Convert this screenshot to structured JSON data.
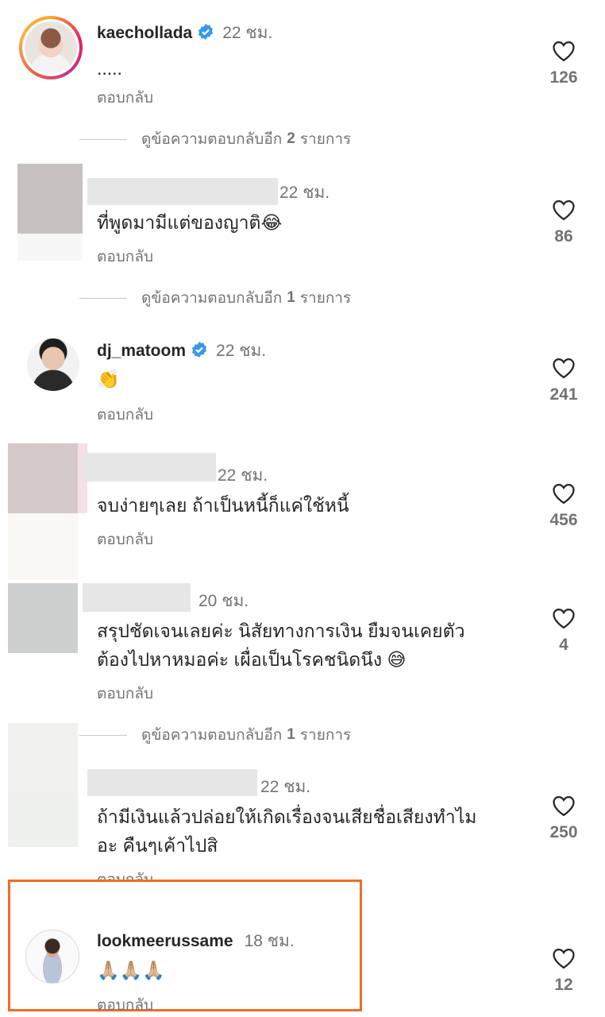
{
  "reply_label": "ตอบกลับ",
  "comments": [
    {
      "username": "kaechollada",
      "verified": true,
      "time": "22 ชม.",
      "text": ".....",
      "likes": "126"
    },
    {
      "username": "",
      "verified": false,
      "time": "22 ชม.",
      "text": "ที่พูดมามีแต่ของญาติ😂",
      "likes": "86"
    },
    {
      "username": "dj_matoom",
      "verified": true,
      "time": "22 ชม.",
      "text": "👏",
      "likes": "241"
    },
    {
      "username": "",
      "verified": false,
      "time": "22 ชม.",
      "text": "จบง่ายๆเลย ถ้าเป็นหนี้ก็แค่ใช้หนี้",
      "likes": "456"
    },
    {
      "username": "",
      "verified": false,
      "time": "20 ชม.",
      "text_line1": "สรุปชัดเจนเลยค่ะ  นิสัยทางการเงิน  ยืมจนเคยตัว",
      "text_line2": "ต้องไปหาหมอค่ะ เผื่อเป็นโรคชนิดนึง 😅",
      "likes": "4"
    },
    {
      "username": "",
      "verified": false,
      "time": "22 ชม.",
      "text_line1": "ถ้ามีเงินแล้วปล่อยให้เกิดเรื่องจนเสียชื่อเสียงทำไม",
      "text_line2": "อะ คืนๆเค้าไปสิ",
      "likes": "250"
    },
    {
      "username": "lookmeerussame",
      "verified": false,
      "time": "18 ชม.",
      "text": "🙏🏼🙏🏼🙏🏼",
      "likes": "12"
    }
  ],
  "view_more": [
    {
      "prefix": "ดูข้อความตอบกลับอีก",
      "count": "2",
      "suffix": "รายการ"
    },
    {
      "prefix": "ดูข้อความตอบกลับอีก",
      "count": "1",
      "suffix": "รายการ"
    },
    {
      "prefix": "ดูข้อความตอบกลับอีก",
      "count": "1",
      "suffix": "รายการ"
    }
  ],
  "highlight_color": "#f26b21",
  "verified_color": "#3897f0"
}
